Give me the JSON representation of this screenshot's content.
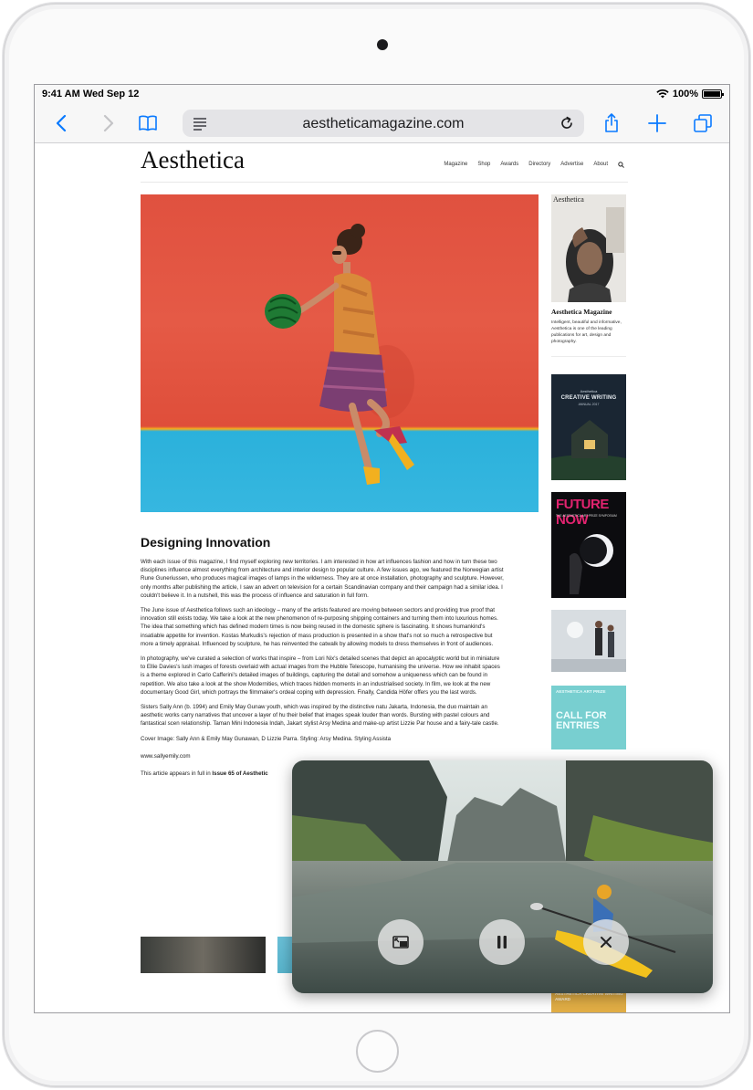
{
  "status_bar": {
    "time_date": "9:41 AM  Wed Sep 12",
    "battery": "100%"
  },
  "toolbar": {
    "url": "aestheticamagazine.com"
  },
  "site": {
    "logo": "Aesthetica",
    "nav": [
      "Magazine",
      "Shop",
      "Awards",
      "Directory",
      "Advertise",
      "About"
    ]
  },
  "article": {
    "title": "Designing Innovation",
    "paragraphs": [
      "With each issue of this magazine, I find myself exploring new territories. I am interested in how art influences fashion and how in turn these two disciplines influence almost everything from architecture and interior design to popular culture. A few issues ago, we featured the Norwegian artist Rune Guneriussen, who produces magical images of lamps in the wilderness. They are at once installation, photography and sculpture. However, only months after publishing the article, I saw an advert on television for a certain Scandinavian company and their campaign had a similar idea. I couldn't believe it. In a nutshell, this was the process of influence and saturation in full form.",
      "The June issue of Aesthetica follows such an ideology – many of the artists featured are moving between sectors and providing true proof that innovation still exists today. We take a look at the new phenomenon of re-purposing shipping containers and turning them into luxurious homes. The idea that something which has defined modern times is now being reused in the domestic sphere is fascinating. It shows humankind's insatiable appetite for invention. Kostas Murkudis's rejection of mass production is presented in a show that's not so much a retrospective but more a timely appraisal. Influenced by sculpture, he has reinvented the catwalk by allowing models to dress themselves in front of audiences.",
      "In photography, we've curated a selection of works that inspire – from Lori Nix's detailed scenes that depict an apocalyptic world but in miniature to Ellie Davies's lush images of forests overlaid with actual images from the Hubble Telescope, humanising the universe. How we inhabit spaces is a theme explored in Carlo Cafferini's detailed images of buildings, capturing the detail and somehow a uniqueness which can be found in repetition. We also take a look at the show Modernities, which traces hidden moments in an industrialised society. In film, we look at the new documentary Good Girl, which portrays the filmmaker's ordeal coping with depression. Finally, Candida Höfer offers you the last words.",
      "Sisters Sally Ann (b. 1994) and Emily May Gunaw youth, which was inspired by the distinctive natu Jakarta, Indonesia, the duo maintain an aesthetic works carry narratives that uncover a layer of hu their belief that images speak louder than words. Bursting with pastel colours and fantastical scen relationship. Taman Mini Indonesia Indah, Jakart stylist Arsy Medina and make-up artist Lizzie Par house and a fairy-tale castle.",
      "Cover Image: Sally Ann & Emily May Gunawan, D Lizzie Parra. Styling: Arsy Medina. Styling Assista",
      "www.sallyemily.com"
    ],
    "issue_prefix": "This article appears in full in ",
    "issue_link": "Issue 65 of Aesthetic"
  },
  "sidebar": {
    "magazine_cover_title": "Aesthetica",
    "magazine_name": "Aesthetica Magazine",
    "magazine_desc": "Intelligent, beautiful and informative, Aesthetica is one of the leading publications for art, design and photography.",
    "ad1": {
      "sub": "Aesthetica",
      "title": "CREATIVE WRITING",
      "sub2": "ANNUAL 2017"
    },
    "ad2": {
      "title": "FUTURE NOW",
      "sub": "THE AESTHETICA ART PRIZE SYMPOSIUM"
    },
    "ad4": {
      "sub": "AESTHETICA ART PRIZE",
      "title": "CALL FOR ENTRIES"
    },
    "ad5": {
      "sub": "AESTHETICA CREATIVE WRITING AWARD"
    }
  },
  "colors": {
    "accent": "#0a7aff",
    "hero_red": "#e0513f",
    "hero_blue": "#36b7e0",
    "ad_pink": "#e2236f",
    "ad_teal": "#78cfd0"
  },
  "pip": {
    "controls": [
      "pip-restore-icon",
      "pause-icon",
      "close-icon"
    ]
  }
}
